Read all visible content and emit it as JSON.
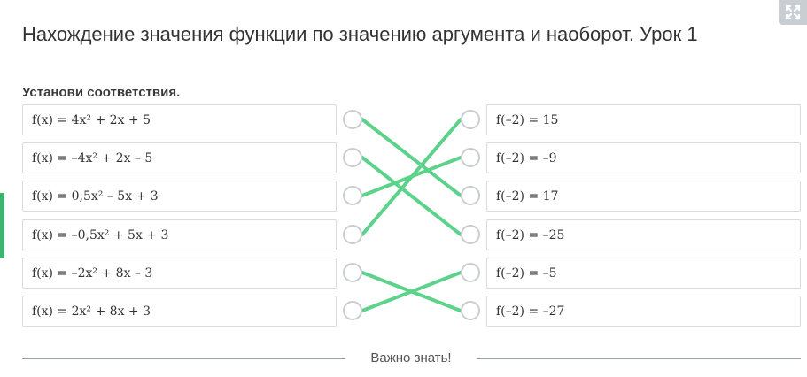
{
  "page": {
    "title": "Нахождение значения функции по значению аргумента и наоборот. Урок 1",
    "instruction": "Установи соответствия.",
    "footer_label": "Важно знать!",
    "expand_icon": "expand-arrows-icon"
  },
  "left_items": [
    {
      "label": "f(x) = 4x² + 2x + 5"
    },
    {
      "label": "f(x) = –4x² + 2x – 5"
    },
    {
      "label": "f(x) = 0,5x² – 5x + 3"
    },
    {
      "label": "f(x) = –0,5x² + 5x + 3"
    },
    {
      "label": "f(x) = –2x² + 8x – 3"
    },
    {
      "label": "f(x) = 2x² + 8x + 3"
    }
  ],
  "right_items": [
    {
      "label": "f(–2) = 15"
    },
    {
      "label": "f(–2) = –9"
    },
    {
      "label": "f(–2) = 17"
    },
    {
      "label": "f(–2) = –25"
    },
    {
      "label": "f(–2) = –5"
    },
    {
      "label": "f(–2) = –27"
    }
  ],
  "connections": [
    [
      0,
      2
    ],
    [
      1,
      3
    ],
    [
      2,
      1
    ],
    [
      3,
      0
    ],
    [
      4,
      5
    ],
    [
      5,
      4
    ]
  ],
  "colors": {
    "connection": "#5dd28a",
    "accent": "#3cb371"
  }
}
